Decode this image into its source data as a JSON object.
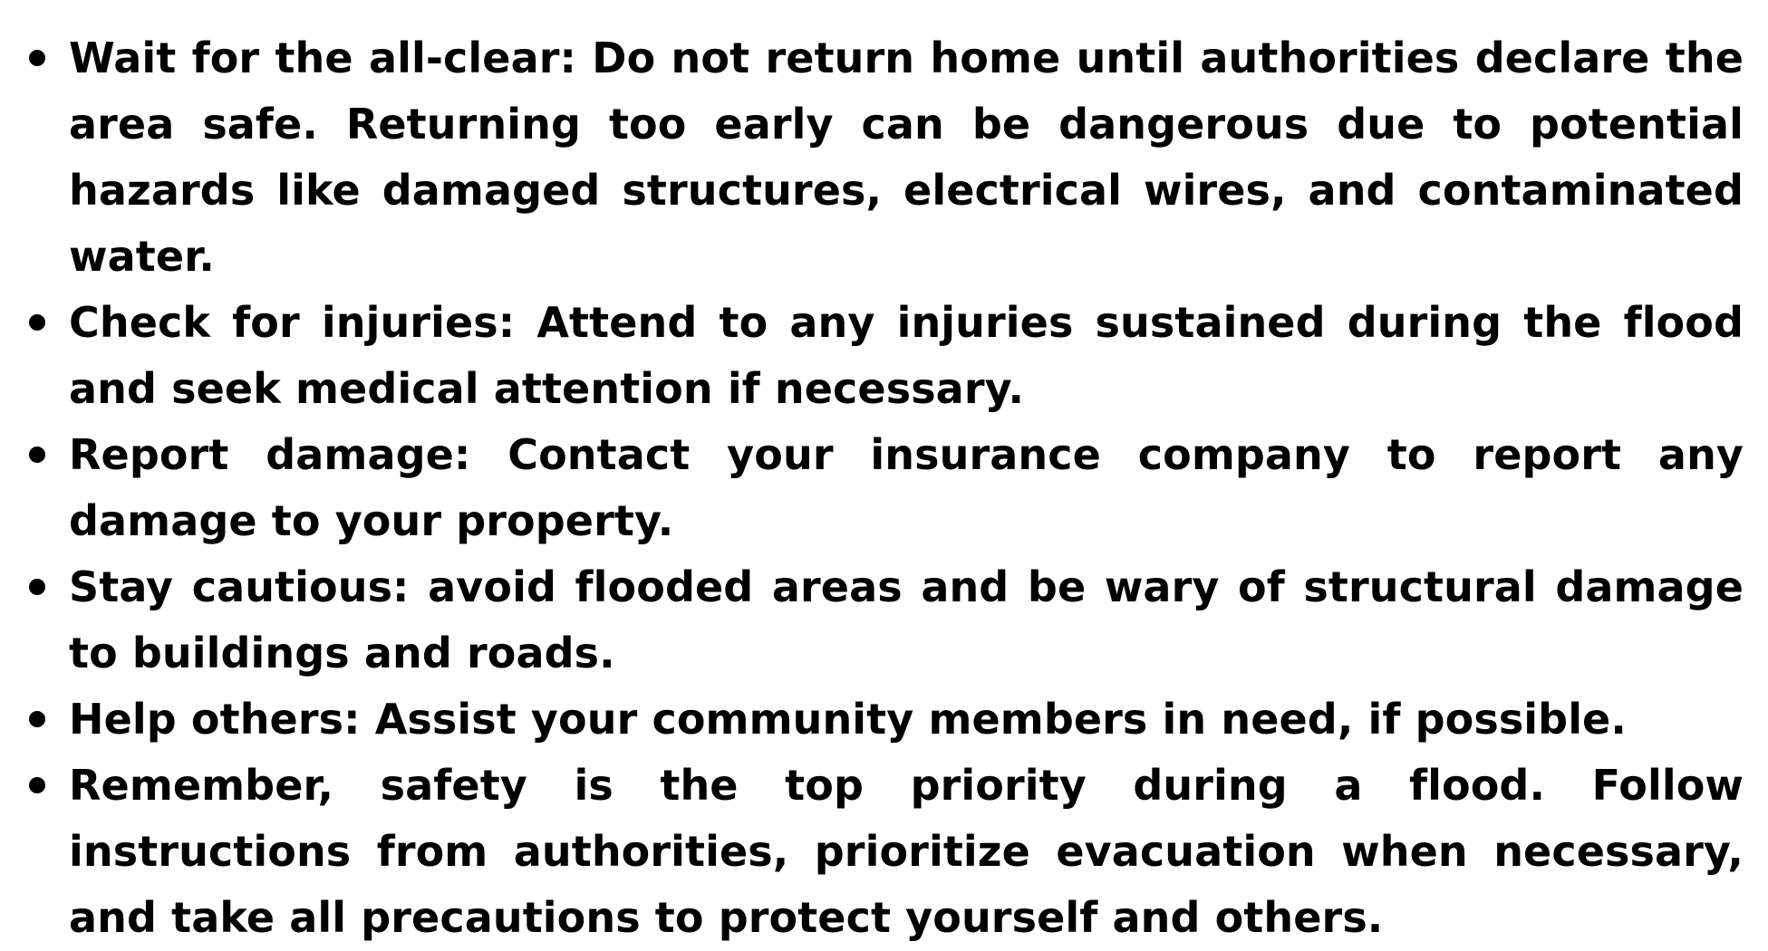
{
  "document": {
    "items": [
      {
        "text": "Wait for the all-clear: Do not return home until authorities declare the area safe. Returning too early can be dangerous due to potential hazards like damaged structures, electrical wires, and contaminated water."
      },
      {
        "text": "Check for injuries: Attend to any injuries sustained during the flood and seek medical attention if necessary."
      },
      {
        "text": "Report damage: Contact your insurance company to report any damage to your property."
      },
      {
        "text": "Stay cautious: avoid flooded areas and be wary of structural damage to buildings and roads."
      },
      {
        "text": "Help others: Assist your community members in need, if possible."
      },
      {
        "text": "Remember, safety is the top priority during a flood. Follow instructions from authorities, prioritize evacuation when necessary, and take all precautions to protect yourself and others."
      }
    ]
  },
  "colors": {
    "text": "#000000",
    "background": "#ffffff"
  }
}
